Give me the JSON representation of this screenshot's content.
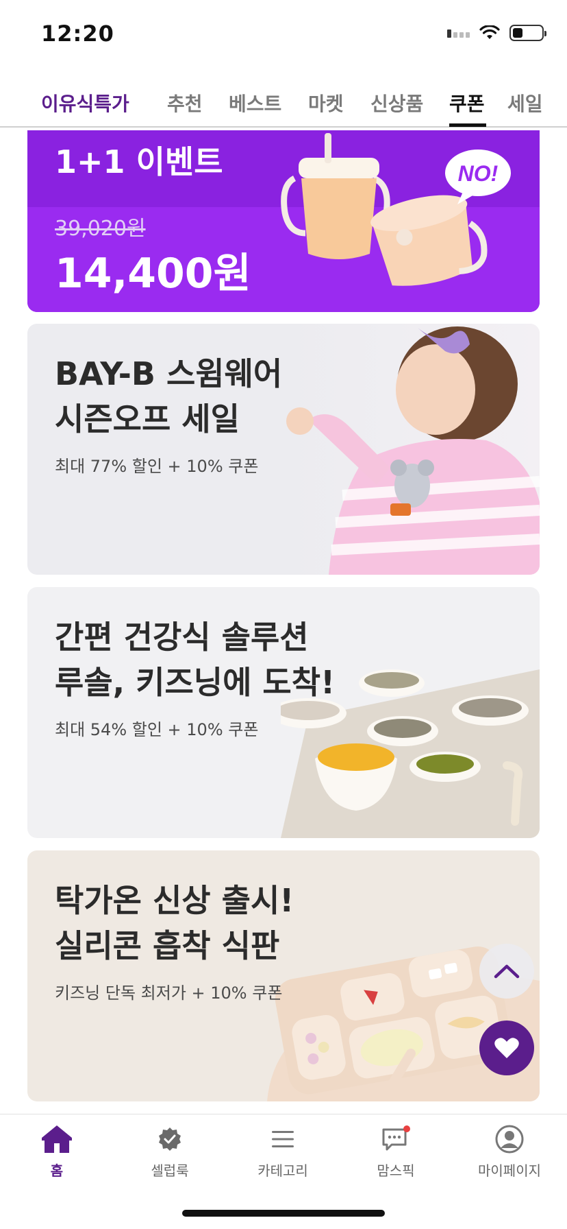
{
  "status_bar": {
    "time": "12:20"
  },
  "top_tabs": {
    "brand": "이유식특가",
    "tabs": [
      {
        "label": "추천"
      },
      {
        "label": "베스트"
      },
      {
        "label": "마켓"
      },
      {
        "label": "신상품"
      },
      {
        "label": "쿠폰",
        "active": true
      },
      {
        "label": "세일"
      }
    ]
  },
  "banners": [
    {
      "title": "1+1 이벤트",
      "original_price": "39,020원",
      "price": "14,400원",
      "badge": "NO!",
      "bg_color": "#8a22e0"
    },
    {
      "title": "BAY-B 스윔웨어\n시즌오프 세일",
      "subtitle": "최대 77% 할인 + 10% 쿠폰"
    },
    {
      "title": "간편 건강식 솔루션\n루솔, 키즈닝에 도착!",
      "subtitle": "최대 54% 할인 + 10% 쿠폰"
    },
    {
      "title": "탁가온 신상 출시!\n실리콘 흡착 식판",
      "subtitle": "키즈닝 단독 최저가 + 10% 쿠폰"
    }
  ],
  "floating": {
    "up_icon": "chevron-up-icon",
    "heart_icon": "heart-icon"
  },
  "bottom_nav": {
    "items": [
      {
        "label": "홈",
        "icon": "home-icon",
        "active": true
      },
      {
        "label": "셀럽룩",
        "icon": "badge-check-icon"
      },
      {
        "label": "카테고리",
        "icon": "menu-icon"
      },
      {
        "label": "맘스픽",
        "icon": "chat-icon",
        "has_dot": true
      },
      {
        "label": "마이페이지",
        "icon": "user-icon"
      }
    ]
  },
  "colors": {
    "accent": "#5b1e8c",
    "banner_purple": "#8a22e0",
    "notification_dot": "#e84040"
  }
}
